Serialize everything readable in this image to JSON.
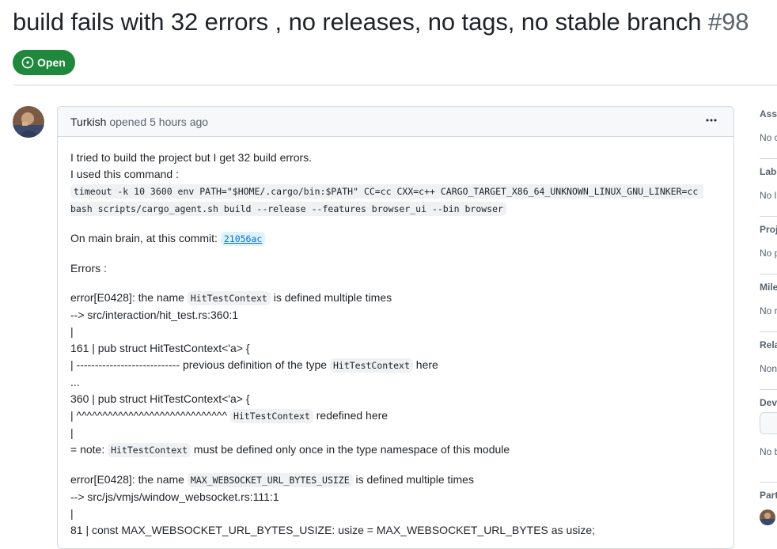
{
  "issue": {
    "title": "build fails with 32 errors , no releases, no tags, no stable branch",
    "number": "#98",
    "state": "Open"
  },
  "comment": {
    "author": "Turkish",
    "action": "opened",
    "time": "5 hours ago",
    "intro_line1": "I tried to build the project but I get 32 build errors.",
    "intro_line2": "I used this command :",
    "command": "timeout -k 10 3600 env PATH=\"$HOME/.cargo/bin:$PATH\" CC=cc CXX=c++ CARGO_TARGET_X86_64_UNKNOWN_LINUX_GNU_LINKER=cc bash scripts/cargo_agent.sh build --release --features browser_ui --bin browser",
    "commit_prefix": "On main brain, at this commit:",
    "commit_hash": "21056ac",
    "errors_label": "Errors :",
    "error1": {
      "l1_pre": "error[E0428]: the name ",
      "l1_code": "HitTestContext",
      "l1_post": " is defined multiple times",
      "l2": "--> src/interaction/hit_test.rs:360:1",
      "l3": "|",
      "l4": "161 | pub struct HitTestContext<'a> {",
      "l5_pre": "| ---------------------------- previous definition of the type ",
      "l5_code": "HitTestContext",
      "l5_post": " here",
      "l6": "...",
      "l7": "360 | pub struct HitTestContext<'a> {",
      "l8_pre": "| ^^^^^^^^^^^^^^^^^^^^^^^^^^^^^ ",
      "l8_code": "HitTestContext",
      "l8_post": " redefined here",
      "l9": "|",
      "l10_pre": "= note: ",
      "l10_code": "HitTestContext",
      "l10_post": " must be defined only once in the type namespace of this module"
    },
    "error2": {
      "l1_pre": "error[E0428]: the name ",
      "l1_code": "MAX_WEBSOCKET_URL_BYTES_USIZE",
      "l1_post": " is defined multiple times",
      "l2": "--> src/js/vmjs/window_websocket.rs:111:1",
      "l3": "|",
      "l4": "81 | const MAX_WEBSOCKET_URL_BYTES_USIZE: usize = MAX_WEBSOCKET_URL_BYTES as usize;"
    }
  },
  "sidebar": {
    "assignees": {
      "label": "Assi",
      "value": "No c"
    },
    "labels": {
      "label": "Labe",
      "value": "No l"
    },
    "projects": {
      "label": "Proj",
      "value": "No p"
    },
    "milestone": {
      "label": "Mile",
      "value": "No r"
    },
    "relationships": {
      "label": "Rela",
      "value": "Non"
    },
    "development": {
      "label": "Deve",
      "value": "No b"
    },
    "participants": {
      "label": "Part"
    }
  },
  "colors": {
    "open_green": "#1f883d",
    "link_blue": "#0969da",
    "muted": "#59636e",
    "border": "#d1d9e0"
  },
  "icons": {
    "state": "issue-opened-icon",
    "menu": "kebab-horizontal-icon"
  }
}
